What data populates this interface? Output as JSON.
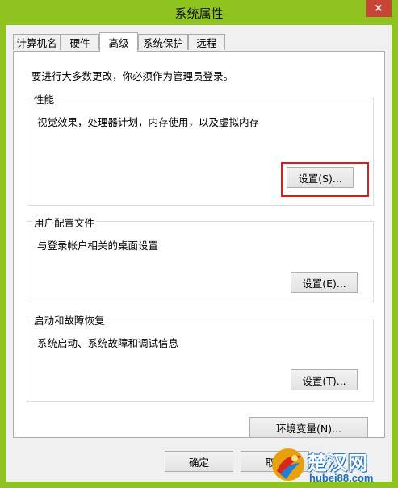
{
  "window": {
    "title": "系统属性",
    "close_glyph": "×"
  },
  "tabs": [
    {
      "label": "计算机名"
    },
    {
      "label": "硬件"
    },
    {
      "label": "高级"
    },
    {
      "label": "系统保护"
    },
    {
      "label": "远程"
    }
  ],
  "advanced": {
    "admin_note": "要进行大多数更改，你必须作为管理员登录。",
    "performance": {
      "title": "性能",
      "description": "视觉效果，处理器计划，内存使用，以及虚拟内存",
      "button": "设置(S)..."
    },
    "user_profiles": {
      "title": "用户配置文件",
      "description": "与登录帐户相关的桌面设置",
      "button": "设置(E)..."
    },
    "startup_recovery": {
      "title": "启动和故障恢复",
      "description": "系统启动、系统故障和调试信息",
      "button": "设置(T)..."
    },
    "env_button": "环境变量(N)..."
  },
  "footer": {
    "ok": "确定",
    "cancel_partial": "取"
  },
  "watermark": {
    "name": "楚汉网",
    "url": "hubei88.com"
  },
  "colors": {
    "frame": "#8fc31f",
    "close": "#c74535",
    "highlight": "#d21f1f"
  }
}
